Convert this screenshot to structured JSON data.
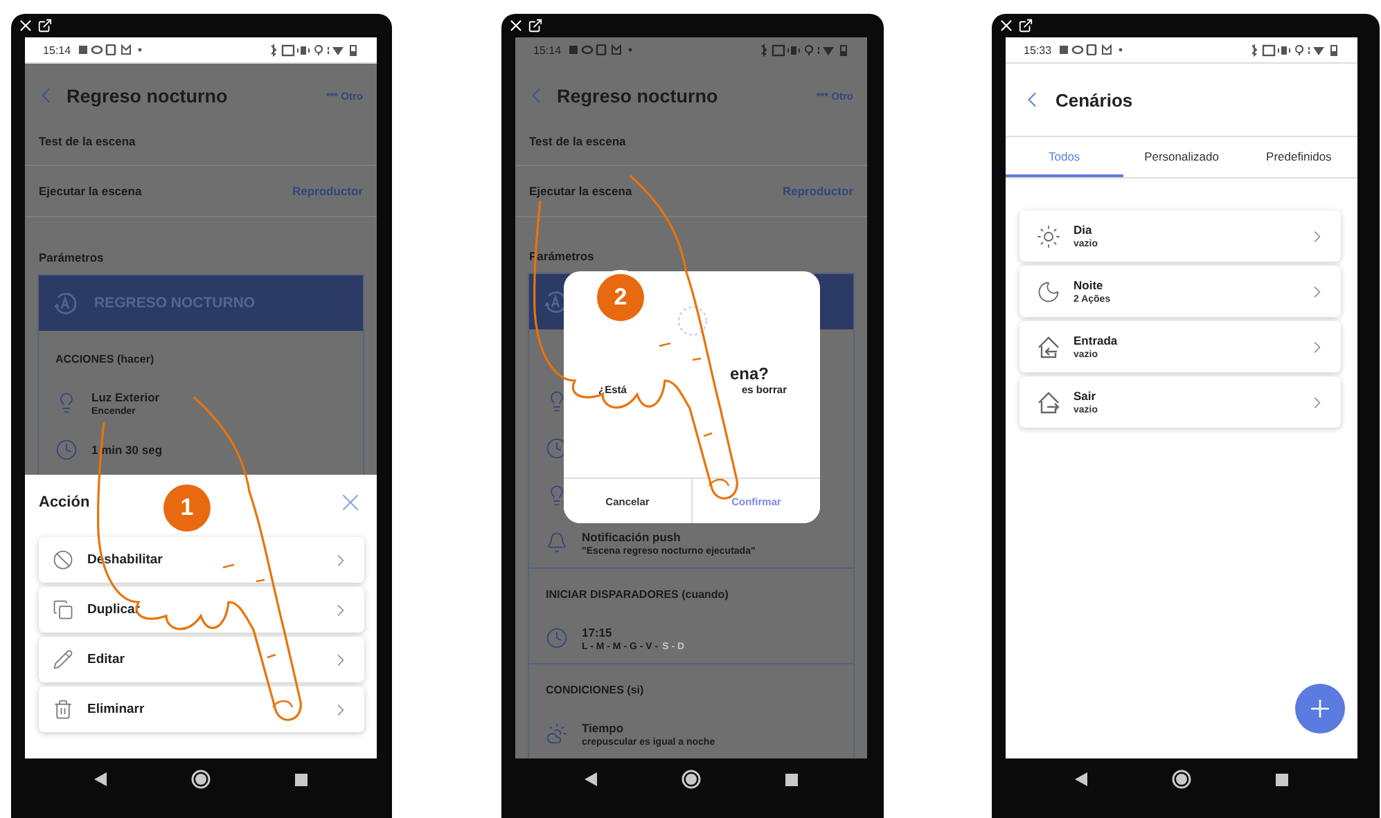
{
  "screen_1": {
    "step": "1",
    "status_bar": {
      "time": "15:14",
      "dimmed": false
    },
    "title": "Regreso nocturno",
    "more": "*** Otro",
    "test_label": "Test de la escena",
    "run_label": "Ejecutar la escena",
    "run_action": "Reproductor",
    "params_label": "Parámetros",
    "scene_name": "REGRESO NOCTURNO",
    "sections": [
      {
        "heading": "ACCIONES (hacer)",
        "items": [
          {
            "kind": "light",
            "title": "Luz Exterior",
            "detail": "Encender"
          },
          {
            "kind": "timer",
            "title": "1 min 30 seg"
          }
        ]
      }
    ],
    "sheet": {
      "title": "Acción",
      "items": [
        {
          "kind": "disable",
          "label": "Deshabilitar"
        },
        {
          "kind": "duplicate",
          "label": "Duplicar"
        },
        {
          "kind": "edit",
          "label": "Editar"
        },
        {
          "kind": "delete",
          "label": "Eliminarr"
        }
      ]
    }
  },
  "screen_2": {
    "step": "2",
    "status_bar": {
      "time": "15:14",
      "dimmed": true
    },
    "title": "Regreso nocturno",
    "more": "*** Otro",
    "test_label": "Test de la escena",
    "run_label": "Ejecutar la escena",
    "run_action": "Reproductor",
    "params_label": "Parámetros",
    "sections": [
      {
        "items": [
          {
            "kind": "light"
          },
          {
            "kind": "timer"
          },
          {
            "kind": "light"
          },
          {
            "kind": "notification",
            "title": "Notificación push",
            "detail": "\"Escena regreso nocturno ejecutada\""
          }
        ]
      },
      {
        "heading": "INICIAR DISPARADORES (cuando)",
        "items": [
          {
            "kind": "timer",
            "title": "17:15",
            "days": [
              {
                "label": "L - M - M - G - V -",
                "active": true
              },
              {
                "label": "S - D",
                "active": false
              }
            ]
          }
        ]
      },
      {
        "heading": "CONDICIONES (si)",
        "items": [
          {
            "kind": "weather",
            "title": "Tiempo",
            "detail": "crepuscular es igual a noche"
          }
        ]
      }
    ],
    "dialog": {
      "title": "ena?",
      "message_start": "¿Está",
      "message_end": "es borrar",
      "buttons": [
        {
          "kind": "cancel",
          "label": "Cancelar"
        },
        {
          "kind": "confirm",
          "label": "Confirmar"
        }
      ]
    }
  },
  "screen_3": {
    "status_bar": {
      "time": "15:33",
      "dimmed": false
    },
    "title": "Cenários",
    "tabs": [
      {
        "label": "Todos",
        "selected": true
      },
      {
        "label": "Personalizado",
        "selected": false
      },
      {
        "label": "Predefinidos",
        "selected": false
      }
    ],
    "scenes": [
      {
        "kind": "day",
        "title": "Dia",
        "detail": "vazio"
      },
      {
        "kind": "night",
        "title": "Noite",
        "detail": "2 Ações"
      },
      {
        "kind": "enter",
        "title": "Entrada",
        "detail": "vazio"
      },
      {
        "kind": "exit",
        "title": "Sair",
        "detail": "vazio"
      }
    ]
  }
}
